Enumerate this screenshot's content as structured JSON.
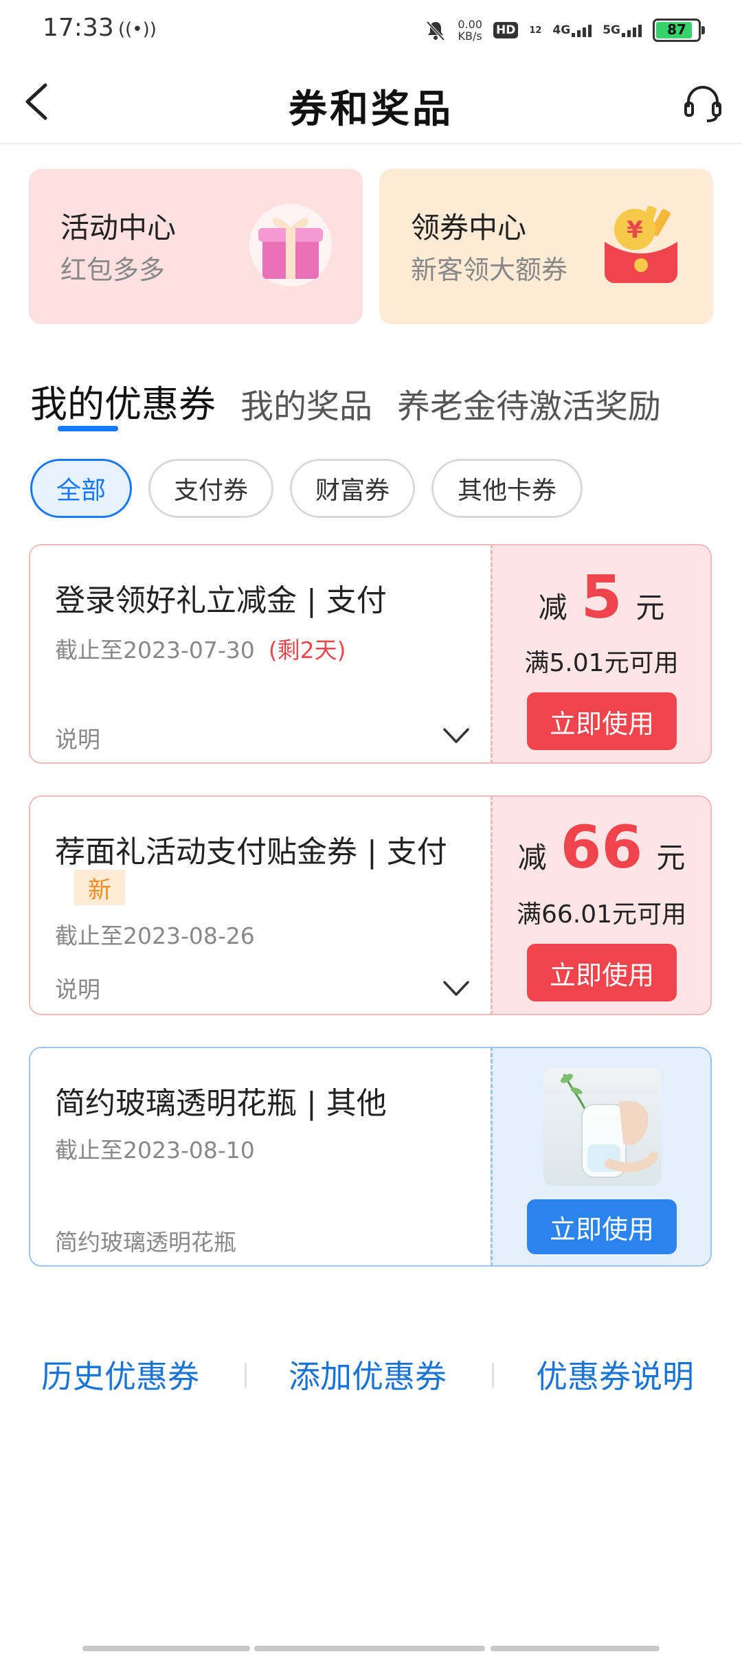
{
  "status_bar": {
    "time": "17:33",
    "hotspot_icon": "((•))",
    "speed_value": "0.00",
    "speed_unit": "KB/s",
    "hd_label": "HD",
    "sim_label": "12",
    "net1": "4G",
    "net2": "5G",
    "battery": "87"
  },
  "header": {
    "title": "券和奖品",
    "back_icon": "chevron-left-icon",
    "service_icon": "headset-icon"
  },
  "promo_cards": [
    {
      "title": "活动中心",
      "subtitle": "红包多多",
      "icon": "gift-icon"
    },
    {
      "title": "领券中心",
      "subtitle": "新客领大额券",
      "icon": "red-envelope-icon"
    }
  ],
  "tabs": [
    {
      "label": "我的优惠券",
      "active": true
    },
    {
      "label": "我的奖品",
      "active": false
    },
    {
      "label": "养老金待激活奖励",
      "active": false
    }
  ],
  "filters": [
    {
      "label": "全部",
      "active": true
    },
    {
      "label": "支付券",
      "active": false
    },
    {
      "label": "财富券",
      "active": false
    },
    {
      "label": "其他卡券",
      "active": false
    }
  ],
  "coupons": [
    {
      "title": "登录领好礼立减金 | 支付",
      "expiry": "截止至2023-07-30",
      "remaining": "(剩2天)",
      "desc": "说明",
      "amount_prefix": "减",
      "amount": "5",
      "amount_suffix": "元",
      "condition": "满5.01元可用",
      "button": "立即使用"
    },
    {
      "title": "荐面礼活动支付贴金券 | 支付",
      "badge": "新",
      "expiry": "截止至2023-08-26",
      "desc": "说明",
      "amount_prefix": "减",
      "amount": "66",
      "amount_suffix": "元",
      "condition": "满66.01元可用",
      "button": "立即使用"
    },
    {
      "title": "简约玻璃透明花瓶 | 其他",
      "expiry": "截止至2023-08-10",
      "desc": "简约玻璃透明花瓶",
      "button": "立即使用"
    }
  ],
  "footer": {
    "history": "历史优惠券",
    "add": "添加优惠券",
    "info": "优惠券说明"
  },
  "colors": {
    "accent_blue": "#1677ff",
    "link_blue": "#1a74d6",
    "coupon_red": "#f0444c",
    "remaining_red": "#e5484d"
  }
}
